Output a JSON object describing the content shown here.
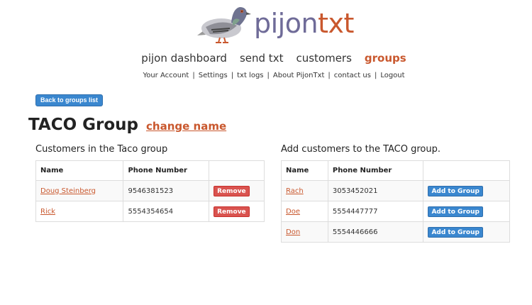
{
  "brand": {
    "logo_part1": "pijon",
    "logo_part2": "txt",
    "logo_icon": "pigeon-icon"
  },
  "main_nav": [
    {
      "label": "pijon dashboard",
      "active": false
    },
    {
      "label": "send txt",
      "active": false
    },
    {
      "label": "customers",
      "active": false
    },
    {
      "label": "groups",
      "active": true
    }
  ],
  "sub_nav": [
    "Your Account",
    "Settings",
    "txt logs",
    "About PijonTxt",
    "contact us",
    "Logout"
  ],
  "sub_nav_separator": "|",
  "back_button": "Back to groups list",
  "group": {
    "title": "TACO Group",
    "change_name": "change name"
  },
  "left_section": {
    "title": "Customers in the Taco group",
    "headers": [
      "Name",
      "Phone Number",
      ""
    ],
    "rows": [
      {
        "name": "Doug Steinberg",
        "phone": "9546381523",
        "action": "Remove"
      },
      {
        "name": "Rick",
        "phone": "5554354654",
        "action": "Remove"
      }
    ]
  },
  "right_section": {
    "title": "Add customers to the TACO group.",
    "headers": [
      "Name",
      "Phone Number",
      ""
    ],
    "rows": [
      {
        "name": "Rach",
        "phone": "3053452021",
        "action": "Add to Group"
      },
      {
        "name": "Doe",
        "phone": "5554447777",
        "action": "Add to Group"
      },
      {
        "name": "Don",
        "phone": "5554446666",
        "action": "Add to Group"
      }
    ]
  },
  "colors": {
    "accent": "#c9582e",
    "logo_purple": "#6f6b98",
    "primary_button": "#3a87cf",
    "danger_button": "#d9534f"
  }
}
